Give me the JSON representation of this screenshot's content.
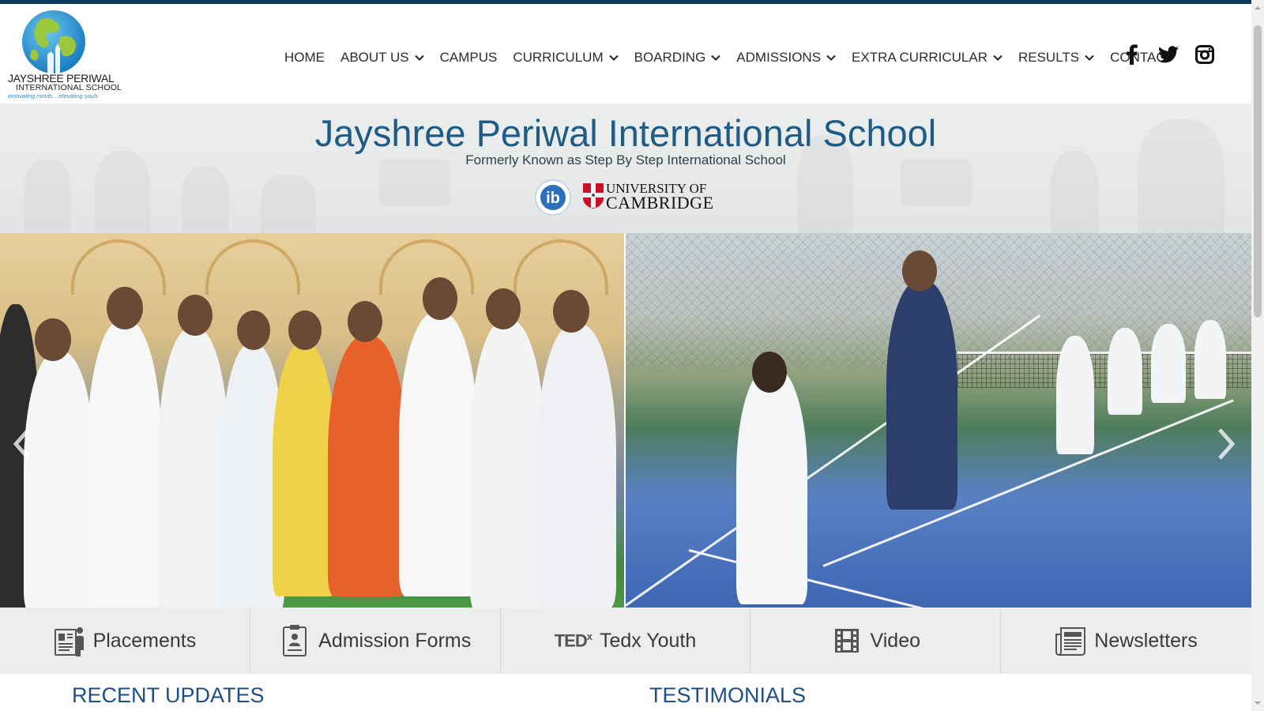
{
  "logo": {
    "name_line1": "JAYSHREE PERIWAL",
    "name_line2": "INTERNATIONAL SCHOOL",
    "tagline": "innovating minds....elevating souls"
  },
  "nav": {
    "items": [
      {
        "label": "HOME",
        "dropdown": false
      },
      {
        "label": "ABOUT US",
        "dropdown": true
      },
      {
        "label": "CAMPUS",
        "dropdown": false
      },
      {
        "label": "CURRICULUM",
        "dropdown": true
      },
      {
        "label": "BOARDING",
        "dropdown": true
      },
      {
        "label": "ADMISSIONS",
        "dropdown": true
      },
      {
        "label": "EXTRA CURRICULAR",
        "dropdown": true
      },
      {
        "label": "RESULTS",
        "dropdown": true
      },
      {
        "label": "CONTACT",
        "dropdown": false
      }
    ]
  },
  "social": [
    "facebook-icon",
    "twitter-icon",
    "instagram-icon"
  ],
  "banner": {
    "title": "Jayshree Periwal International School",
    "subtitle": "Formerly Known as Step By Step International School",
    "cambridge_line1": "UNIVERSITY OF",
    "cambridge_line2": "CAMBRIDGE"
  },
  "quick_links": [
    {
      "label": "Placements",
      "icon": "placements-icon"
    },
    {
      "label": "Admission Forms",
      "icon": "admission-form-icon"
    },
    {
      "label": "Tedx Youth",
      "icon": "tedx-logo"
    },
    {
      "label": "Video",
      "icon": "video-film-icon"
    },
    {
      "label": "Newsletters",
      "icon": "newspaper-icon"
    }
  ],
  "sections": {
    "recent_updates": "RECENT UPDATES",
    "testimonials": "TESTIMONIALS"
  },
  "colors": {
    "brand_dark": "#0d3a5c",
    "title_blue": "#1f5b87",
    "section_blue": "#1f4f82"
  }
}
